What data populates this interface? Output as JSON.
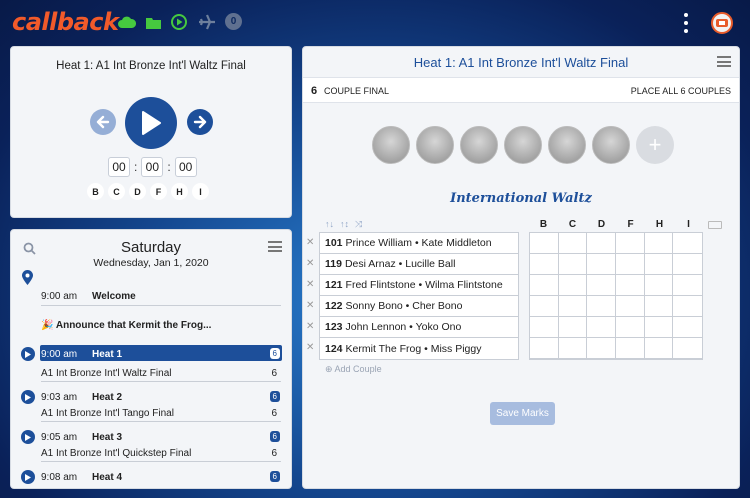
{
  "app": {
    "logo": "callback",
    "notification_count": "0"
  },
  "player": {
    "title": "Heat 1: A1 Int Bronze Int'l Waltz Final",
    "timer": [
      "00",
      "00",
      "00"
    ],
    "letters": [
      "B",
      "C",
      "D",
      "F",
      "H",
      "I"
    ]
  },
  "schedule": {
    "day": "Saturday",
    "date": "Wednesday, Jan 1, 2020",
    "items": [
      {
        "time": "9:00 am",
        "title": "Welcome"
      },
      {
        "announce": "🎉 Announce that Kermit the Frog..."
      },
      {
        "time": "9:00 am",
        "title": "Heat 1",
        "badge": "6",
        "sub": "A1 Int Bronze Int'l Waltz Final",
        "count": "6",
        "active": true
      },
      {
        "time": "9:03 am",
        "title": "Heat 2",
        "badge": "6",
        "sub": "A1 Int Bronze Int'l Tango Final",
        "count": "6"
      },
      {
        "time": "9:05 am",
        "title": "Heat 3",
        "badge": "6",
        "sub": "A1 Int Bronze Int'l Quickstep Final",
        "count": "6"
      },
      {
        "time": "9:08 am",
        "title": "Heat 4",
        "badge": "6"
      }
    ]
  },
  "main": {
    "title": "Heat 1: A1 Int Bronze Int'l Waltz Final",
    "couple_count": "6",
    "couple_final_label": "COUPLE FINAL",
    "place_all_label": "PLACE ALL 6 COUPLES",
    "dance": "International Waltz",
    "couples": [
      {
        "number": "101",
        "names": "Prince William • Kate Middleton"
      },
      {
        "number": "119",
        "names": "Desi Arnaz • Lucille Ball"
      },
      {
        "number": "121",
        "names": "Fred Flintstone • Wilma Flintstone"
      },
      {
        "number": "122",
        "names": "Sonny Bono • Cher Bono"
      },
      {
        "number": "123",
        "names": "John Lennon • Yoko Ono"
      },
      {
        "number": "124",
        "names": "Kermit The Frog • Miss Piggy"
      }
    ],
    "judge_columns": [
      "B",
      "C",
      "D",
      "F",
      "H",
      "I"
    ],
    "add_couple_label": "Add Couple",
    "save_label": "Save Marks"
  }
}
